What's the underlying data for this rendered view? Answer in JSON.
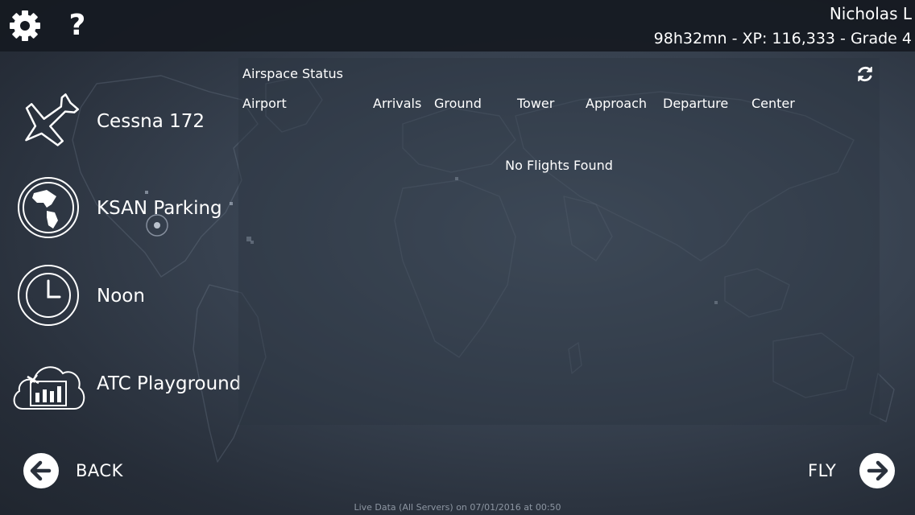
{
  "header": {
    "settings_icon": "gear-icon",
    "help_label": "?",
    "user_name": "Nicholas L",
    "user_stats": "98h32mn - XP: 116,333 - Grade 4"
  },
  "menu": [
    {
      "label": "Cessna 172",
      "icon": "airplane-icon"
    },
    {
      "label": "KSAN Parking",
      "icon": "globe-icon"
    },
    {
      "label": "Noon",
      "icon": "clock-icon"
    },
    {
      "label": "ATC Playground",
      "icon": "cloud-server-icon"
    }
  ],
  "airspace": {
    "title": "Airspace Status",
    "refresh_icon": "refresh-icon",
    "columns": [
      "Airport",
      "Arrivals",
      "Ground",
      "Tower",
      "Approach",
      "Departure",
      "Center"
    ],
    "empty_message": "No Flights Found"
  },
  "nav": {
    "back_label": "BACK",
    "fly_label": "FLY"
  },
  "footer": {
    "status": "Live Data (All Servers) on 07/01/2016 at 00:50"
  },
  "colors": {
    "background": "#37414f",
    "topbar": "#161a21",
    "text": "#ffffff",
    "muted_text": "#8d96a2"
  }
}
